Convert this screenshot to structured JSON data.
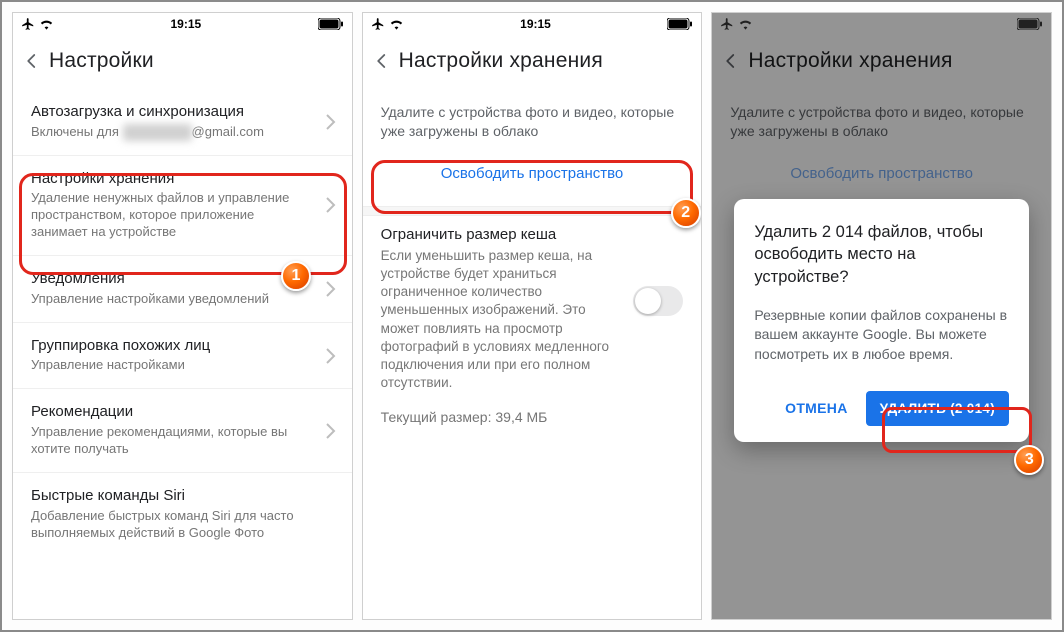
{
  "statusbar": {
    "time": "19:15"
  },
  "screen1": {
    "title": "Настройки",
    "rows": {
      "autoupload": {
        "label": "Автозагрузка и синхронизация",
        "sub_prefix": "Включены для ",
        "sub_blurred": "xxxxxxxxxx",
        "sub_suffix": "@gmail.com"
      },
      "storage": {
        "label": "Настройки хранения",
        "sub": "Удаление ненужных файлов и управление пространством, которое приложение занимает на устройстве"
      },
      "notifications": {
        "label": "Уведомления",
        "sub": "Управление настройками уведомлений"
      },
      "faces": {
        "label": "Группировка похожих лиц",
        "sub": "Управление настройками"
      },
      "recs": {
        "label": "Рекомендации",
        "sub": "Управление рекомендациями, которые вы хотите получать"
      },
      "siri": {
        "label": "Быстрые команды Siri",
        "sub": "Добавление быстрых команд Siri для часто выполняемых действий в Google Фото"
      }
    }
  },
  "screen2": {
    "title": "Настройки хранения",
    "note": "Удалите с устройства фото и видео, которые уже загружены в облако",
    "freeup": "Освободить пространство",
    "cache": {
      "title": "Ограничить размер кеша",
      "desc": "Если уменьшить размер кеша, на устройстве будет храниться ограниченное количество уменьшенных изображений. Это может повлиять на просмотр фотографий в условиях медленного подключения или при его полном отсутствии.",
      "size": "Текущий размер: 39,4 МБ"
    }
  },
  "screen3": {
    "title": "Настройки хранения",
    "note": "Удалите с устройства фото и видео, которые уже загружены в облако",
    "freeup_faded": "Освободить пространство",
    "alert": {
      "question": "Удалить 2 014 файлов, чтобы освободить место на устройстве?",
      "message": "Резервные копии файлов сохранены в вашем аккаунте Google. Вы можете посмотреть их в любое время.",
      "cancel": "ОТМЕНА",
      "delete": "УДАЛИТЬ (2 014)"
    }
  },
  "badges": {
    "b1": "1",
    "b2": "2",
    "b3": "3"
  }
}
